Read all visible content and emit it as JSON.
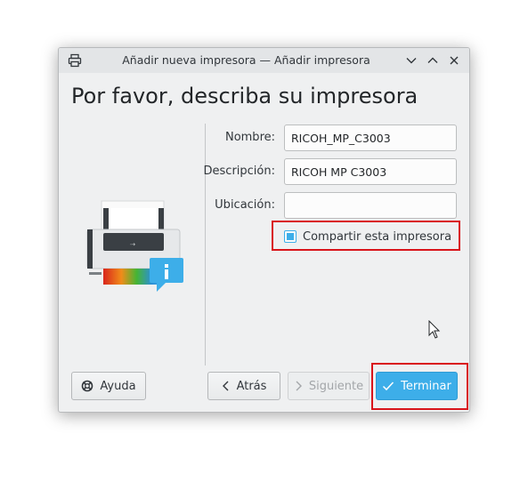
{
  "window": {
    "title": "Añadir nueva impresora — Añadir impresora",
    "heading": "Por favor, describa su impresora"
  },
  "form": {
    "name_label": "Nombre:",
    "name_value": "RICOH_MP_C3003",
    "description_label": "Descripción:",
    "description_value": "RICOH MP C3003",
    "location_label": "Ubicación:",
    "location_value": "",
    "share_label": "Compartir esta impresora",
    "share_checked": true
  },
  "buttons": {
    "help": "Ayuda",
    "back": "Atrás",
    "next": "Siguiente",
    "finish": "Terminar"
  },
  "icons": {
    "window_icon": "printer-icon",
    "minimize": "chevron-down-icon",
    "maximize": "chevron-up-icon",
    "close": "close-icon",
    "illustration": "printer-info-illustration"
  },
  "colors": {
    "accent": "#3daee9",
    "highlight": "#d9141b"
  }
}
